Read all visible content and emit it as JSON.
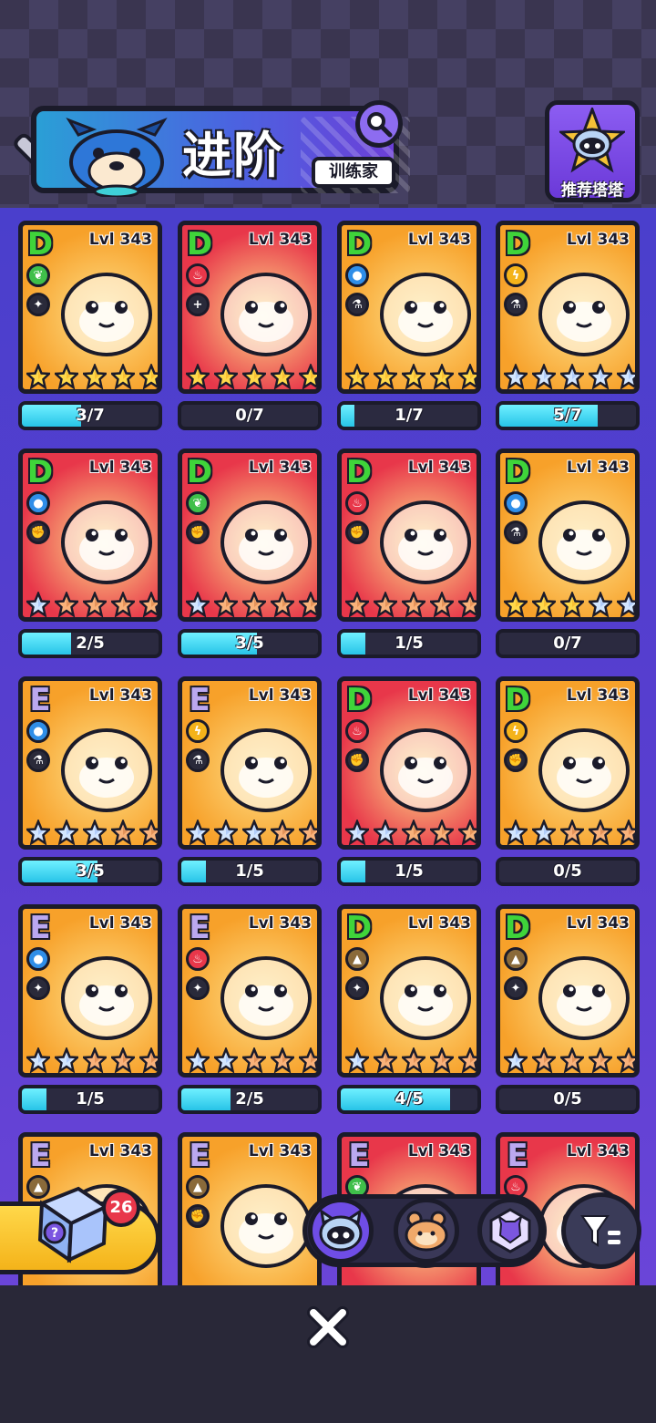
{
  "header": {
    "title": "进阶",
    "subtitle": "训练家",
    "recommend_label": "推荐塔塔"
  },
  "colors": {
    "fire": "#e8374a",
    "water": "#2f8ee8",
    "nature": "#3fbf4a",
    "electric": "#f4b31a",
    "earth": "#8a6a3a",
    "progress": "#27c4e8"
  },
  "cards": [
    {
      "grade": "D",
      "level": "Lvl 343",
      "element": "nature",
      "role": "summon",
      "gold_stars": 5,
      "silver_stars": 0,
      "bronze_stars": 0,
      "progress": "3/7",
      "fill": 0.43,
      "bg": "#f7a12a"
    },
    {
      "grade": "D",
      "level": "Lvl 343",
      "element": "fire",
      "role": "healer",
      "gold_stars": 5,
      "silver_stars": 0,
      "bronze_stars": 0,
      "progress": "0/7",
      "fill": 0,
      "bg": "#e8374a"
    },
    {
      "grade": "D",
      "level": "Lvl 343",
      "element": "water",
      "role": "support",
      "gold_stars": 5,
      "silver_stars": 0,
      "bronze_stars": 0,
      "progress": "1/7",
      "fill": 0.1,
      "bg": "#f7a12a"
    },
    {
      "grade": "D",
      "level": "Lvl 343",
      "element": "electric",
      "role": "support",
      "gold_stars": 0,
      "silver_stars": 5,
      "bronze_stars": 0,
      "progress": "5/7",
      "fill": 0.72,
      "bg": "#f7a12a"
    },
    {
      "grade": "D",
      "level": "Lvl 343",
      "element": "water",
      "role": "melee",
      "gold_stars": 0,
      "silver_stars": 1,
      "bronze_stars": 4,
      "progress": "2/5",
      "fill": 0.36,
      "bg": "#e8374a"
    },
    {
      "grade": "D",
      "level": "Lvl 343",
      "element": "nature",
      "role": "melee",
      "gold_stars": 0,
      "silver_stars": 1,
      "bronze_stars": 4,
      "progress": "3/5",
      "fill": 0.55,
      "bg": "#e8374a"
    },
    {
      "grade": "D",
      "level": "Lvl 343",
      "element": "fire",
      "role": "melee",
      "gold_stars": 0,
      "silver_stars": 0,
      "bronze_stars": 5,
      "progress": "1/5",
      "fill": 0.18,
      "bg": "#e8374a"
    },
    {
      "grade": "D",
      "level": "Lvl 343",
      "element": "water",
      "role": "support",
      "gold_stars": 3,
      "silver_stars": 2,
      "bronze_stars": 0,
      "progress": "0/7",
      "fill": 0,
      "bg": "#f7a12a"
    },
    {
      "grade": "E",
      "level": "Lvl 343",
      "element": "water",
      "role": "support",
      "gold_stars": 0,
      "silver_stars": 3,
      "bronze_stars": 2,
      "progress": "3/5",
      "fill": 0.55,
      "bg": "#f7a12a"
    },
    {
      "grade": "E",
      "level": "Lvl 343",
      "element": "electric",
      "role": "support",
      "gold_stars": 0,
      "silver_stars": 3,
      "bronze_stars": 2,
      "progress": "1/5",
      "fill": 0.18,
      "bg": "#f7a12a"
    },
    {
      "grade": "D",
      "level": "Lvl 343",
      "element": "fire",
      "role": "melee",
      "gold_stars": 0,
      "silver_stars": 2,
      "bronze_stars": 3,
      "progress": "1/5",
      "fill": 0.18,
      "bg": "#e8374a"
    },
    {
      "grade": "D",
      "level": "Lvl 343",
      "element": "electric",
      "role": "melee",
      "gold_stars": 0,
      "silver_stars": 2,
      "bronze_stars": 3,
      "progress": "0/5",
      "fill": 0,
      "bg": "#f7a12a"
    },
    {
      "grade": "E",
      "level": "Lvl 343",
      "element": "water",
      "role": "summon",
      "gold_stars": 0,
      "silver_stars": 2,
      "bronze_stars": 3,
      "progress": "1/5",
      "fill": 0.18,
      "bg": "#f7a12a"
    },
    {
      "grade": "E",
      "level": "Lvl 343",
      "element": "fire",
      "role": "summon",
      "gold_stars": 0,
      "silver_stars": 2,
      "bronze_stars": 3,
      "progress": "2/5",
      "fill": 0.36,
      "bg": "#f7a12a"
    },
    {
      "grade": "D",
      "level": "Lvl 343",
      "element": "earth",
      "role": "summon",
      "gold_stars": 0,
      "silver_stars": 1,
      "bronze_stars": 4,
      "progress": "4/5",
      "fill": 0.8,
      "bg": "#f7a12a"
    },
    {
      "grade": "D",
      "level": "Lvl 343",
      "element": "earth",
      "role": "summon",
      "gold_stars": 0,
      "silver_stars": 1,
      "bronze_stars": 4,
      "progress": "0/5",
      "fill": 0,
      "bg": "#f7a12a"
    },
    {
      "grade": "E",
      "level": "Lvl 343",
      "element": "earth",
      "role": "summon",
      "gold_stars": 0,
      "silver_stars": 0,
      "bronze_stars": 0,
      "progress": "",
      "fill": 0,
      "bg": "#f7a12a"
    },
    {
      "grade": "E",
      "level": "Lvl 343",
      "element": "earth",
      "role": "melee",
      "gold_stars": 0,
      "silver_stars": 0,
      "bronze_stars": 0,
      "progress": "",
      "fill": 0,
      "bg": "#f7a12a"
    },
    {
      "grade": "E",
      "level": "Lvl 343",
      "element": "nature",
      "role": "summon",
      "gold_stars": 0,
      "silver_stars": 0,
      "bronze_stars": 0,
      "progress": "",
      "fill": 0,
      "bg": "#e8374a"
    },
    {
      "grade": "E",
      "level": "Lvl 343",
      "element": "fire",
      "role": "summon",
      "gold_stars": 0,
      "silver_stars": 0,
      "bronze_stars": 0,
      "progress": "",
      "fill": 0,
      "bg": "#e8374a"
    }
  ],
  "mystery_box": {
    "count": "26"
  },
  "tabs": [
    {
      "name": "tower-tab",
      "active": true
    },
    {
      "name": "hamster-tab",
      "active": false
    },
    {
      "name": "crystal-cat-tab",
      "active": false
    }
  ]
}
